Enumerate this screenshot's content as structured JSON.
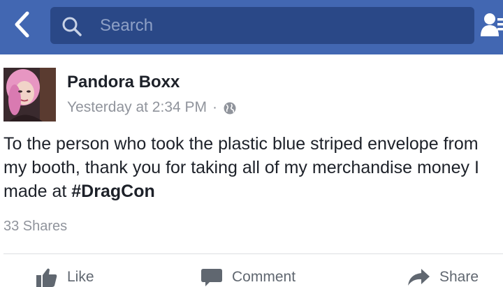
{
  "header": {
    "search_placeholder": "Search",
    "bar_color": "#4267b2",
    "back_icon": "chevron-left-icon",
    "friends_icon": "friend-requests-icon"
  },
  "post": {
    "author": "Pandora Boxx",
    "timestamp": "Yesterday at 2:34 PM",
    "separator": "·",
    "privacy_icon": "globe-icon",
    "text_main": "To the person who took the plastic blue striped envelope from my booth, thank you for taking all of my merchandise money I made at ",
    "hashtag": "#DragCon",
    "shares": "33 Shares"
  },
  "actions": {
    "like": "Like",
    "comment": "Comment",
    "share": "Share"
  }
}
